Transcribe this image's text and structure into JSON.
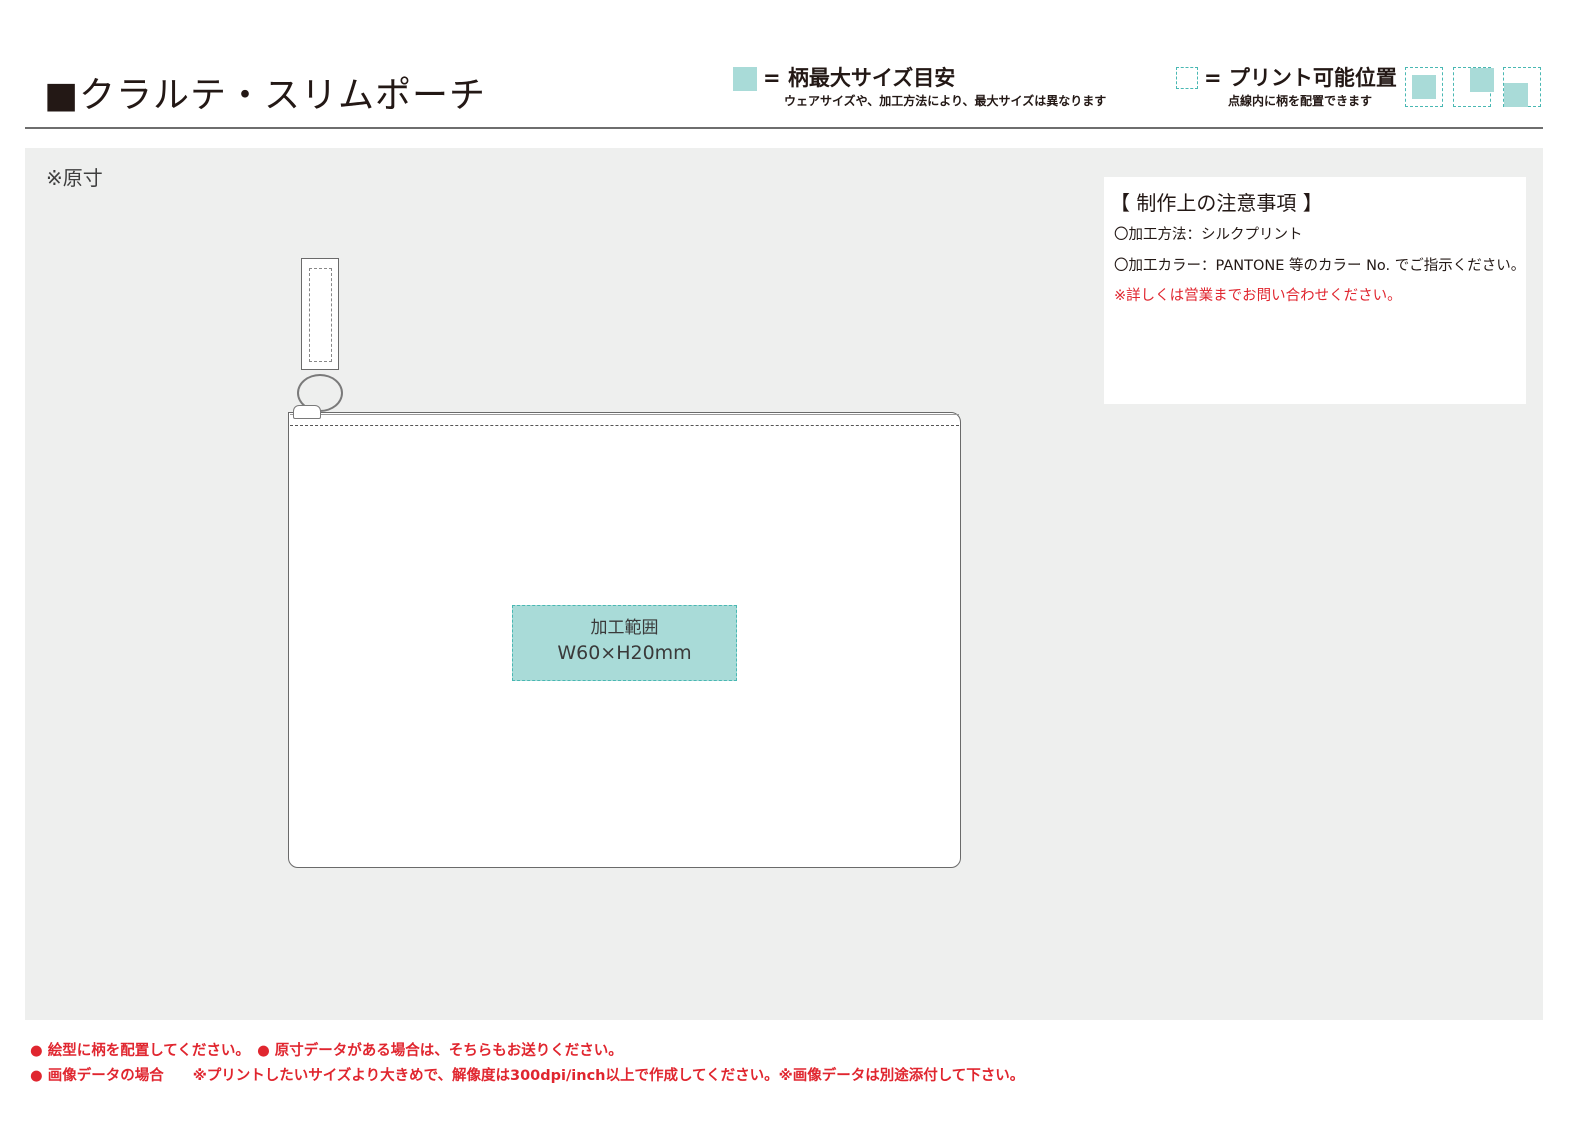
{
  "header": {
    "title": "■クラルテ・スリムポーチ",
    "legend_max": {
      "main": "= 柄最大サイズ目安",
      "sub": "ウェアサイズや、加工方法により、最大サイズは異なります",
      "color": "#a9dbd8"
    },
    "legend_print": {
      "main": "= プリント可能位置",
      "sub": "点線内に柄を配置できます",
      "color": "#49b8b3"
    }
  },
  "canvas": {
    "scale_note": "※原寸",
    "background": "#eeefee"
  },
  "notes": {
    "title": "【 制作上の注意事項 】",
    "lines": [
      "〇加工方法：シルクプリント",
      "〇加工カラー：PANTONE 等のカラー No. でご指示ください。"
    ],
    "warning": "※詳しくは営業までお問い合わせください。",
    "warning_color": "#e0262f"
  },
  "print_area": {
    "label": "加工範囲",
    "dimensions": "W60×H20mm"
  },
  "footer": {
    "line1": "● 絵型に柄を配置してください。　● 原寸データがある場合は、そちらもお送りください。",
    "line2": "● 画像データの場合　　※プリントしたいサイズより大きめで、解像度は300dpi/inch以上で作成してください。※画像データは別途添付して下さい。",
    "color": "#e0262f"
  }
}
